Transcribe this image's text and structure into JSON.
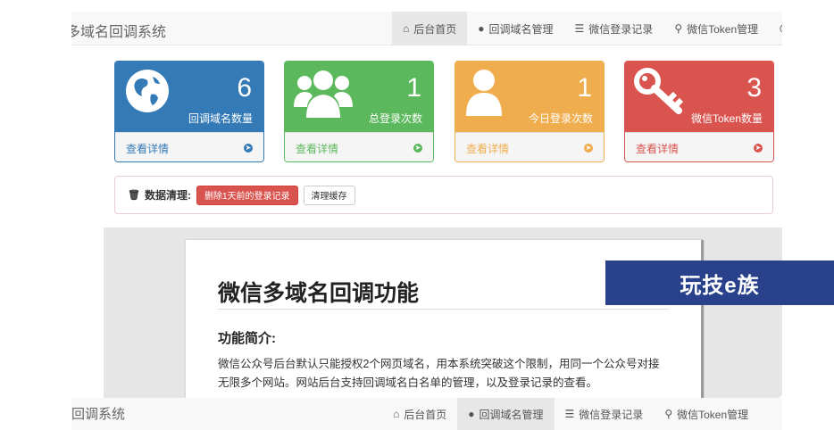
{
  "app": {
    "brand": "多域名回调系统"
  },
  "nav": {
    "items": [
      {
        "label": "后台首页",
        "icon": "home-icon",
        "active": true
      },
      {
        "label": "回调域名管理",
        "icon": "globe-icon",
        "active": false
      },
      {
        "label": "微信登录记录",
        "icon": "list-icon",
        "active": false
      },
      {
        "label": "微信Token管理",
        "icon": "key-icon",
        "active": false
      }
    ]
  },
  "stats": [
    {
      "value": "6",
      "caption": "回调域名数量",
      "link": "查看详情",
      "icon": "globe-icon",
      "color": "#337ab7"
    },
    {
      "value": "1",
      "caption": "总登录次数",
      "link": "查看详情",
      "icon": "users-icon",
      "color": "#5cb85c"
    },
    {
      "value": "1",
      "caption": "今日登录次数",
      "link": "查看详情",
      "icon": "user-icon",
      "color": "#f0ad4e"
    },
    {
      "value": "3",
      "caption": "微信Token数量",
      "link": "查看详情",
      "icon": "key-icon",
      "color": "#d9534f"
    }
  ],
  "cleanup": {
    "label": "数据清理:",
    "delete_button": "删除1天前的登录记录",
    "clear_cache_button": "清理缓存"
  },
  "doc": {
    "title": "微信多域名回调功能",
    "subtitle": "功能简介:",
    "body": "微信公众号后台默认只能授权2个网页域名，用本系统突破这个限制，用同一个公众号对接无限多个网站。网站后台支持回调域名白名单的管理，以及登录记录的查看。"
  },
  "watermark": {
    "text": "玩技e族"
  },
  "bottom_nav": {
    "brand": "回调系统",
    "items": [
      {
        "label": "后台首页",
        "icon": "home-icon",
        "active": false
      },
      {
        "label": "回调域名管理",
        "icon": "globe-icon",
        "active": true
      },
      {
        "label": "微信登录记录",
        "icon": "list-icon",
        "active": false
      },
      {
        "label": "微信Token管理",
        "icon": "key-icon",
        "active": false
      }
    ]
  }
}
